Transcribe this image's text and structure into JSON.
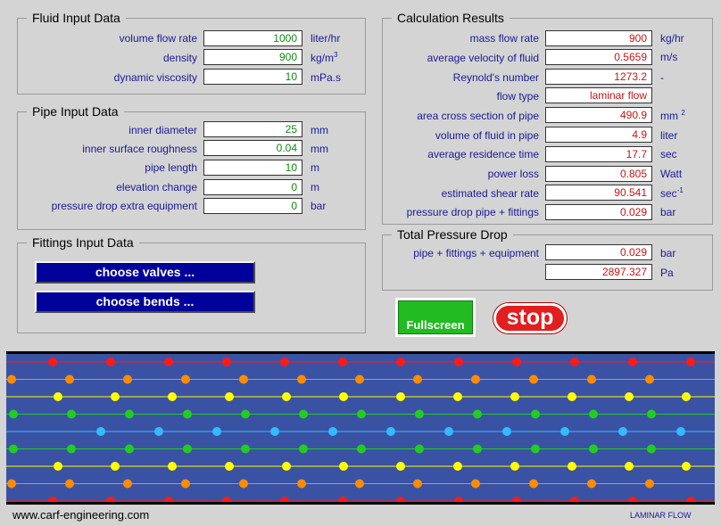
{
  "fluid_input": {
    "title": "Fluid Input Data",
    "rows": [
      {
        "label": "volume flow rate",
        "value": "1000",
        "unit": "liter/hr"
      },
      {
        "label": "density",
        "value": "900",
        "unit": "kg/m",
        "unit_sup": "3"
      },
      {
        "label": "dynamic viscosity",
        "value": "10",
        "unit": "mPa.s"
      }
    ]
  },
  "pipe_input": {
    "title": "Pipe Input Data",
    "rows": [
      {
        "label": "inner diameter",
        "value": "25",
        "unit": "mm"
      },
      {
        "label": "inner surface roughness",
        "value": "0.04",
        "unit": "mm"
      },
      {
        "label": "pipe length",
        "value": "10",
        "unit": "m"
      },
      {
        "label": "elevation change",
        "value": "0",
        "unit": "m"
      },
      {
        "label": "pressure drop extra equipment",
        "value": "0",
        "unit": "bar"
      }
    ]
  },
  "fittings_input": {
    "title": "Fittings Input Data",
    "valves_button": "choose valves ...",
    "bends_button": "choose bends ..."
  },
  "calc_results": {
    "title": "Calculation Results",
    "rows": [
      {
        "label": "mass flow rate",
        "value": "900",
        "unit": "kg/hr"
      },
      {
        "label": "average velocity of fluid",
        "value": "0.5659",
        "unit": "m/s"
      },
      {
        "label": "Reynold's number",
        "value": "1273.2",
        "unit": "-"
      },
      {
        "label": "flow type",
        "value": "laminar flow",
        "unit": ""
      },
      {
        "label": "area cross section of pipe",
        "value": "490.9",
        "unit": "mm",
        "unit_sup": "2"
      },
      {
        "label": "volume of fluid in pipe",
        "value": "4.9",
        "unit": "liter"
      },
      {
        "label": "average residence time",
        "value": "17.7",
        "unit": "sec"
      },
      {
        "label": "power loss",
        "value": "0.805",
        "unit": "Watt"
      },
      {
        "label": "estimated shear rate",
        "value": "90.541",
        "unit": "sec",
        "unit_sup": "-1"
      },
      {
        "label": "pressure drop pipe + fittings",
        "value": "0.029",
        "unit": "bar"
      }
    ]
  },
  "total_pressure": {
    "title": "Total Pressure Drop",
    "label": "pipe + fittings + equipment",
    "value_bar": "0.029",
    "unit_bar": "bar",
    "value_pa": "2897.327",
    "unit_pa": "Pa"
  },
  "controls": {
    "fullscreen_label": "Fullscreen",
    "stop_label": "stop"
  },
  "flow_animation": {
    "background": "#3a52a4",
    "lanes": [
      {
        "color": "#ff1a1a",
        "dots": 12
      },
      {
        "color": "#ff8c00",
        "dots": 12
      },
      {
        "color": "#ffff00",
        "dots": 12
      },
      {
        "color": "#22cc22",
        "dots": 12
      },
      {
        "color": "#33bbff",
        "dots": 12
      },
      {
        "color": "#22cc22",
        "dots": 12
      },
      {
        "color": "#ffff00",
        "dots": 12
      },
      {
        "color": "#ff8c00",
        "dots": 12
      },
      {
        "color": "#ff1a1a",
        "dots": 12
      }
    ]
  },
  "footer": {
    "url": "www.carf-engineering.com",
    "status": "LAMINAR FLOW"
  }
}
